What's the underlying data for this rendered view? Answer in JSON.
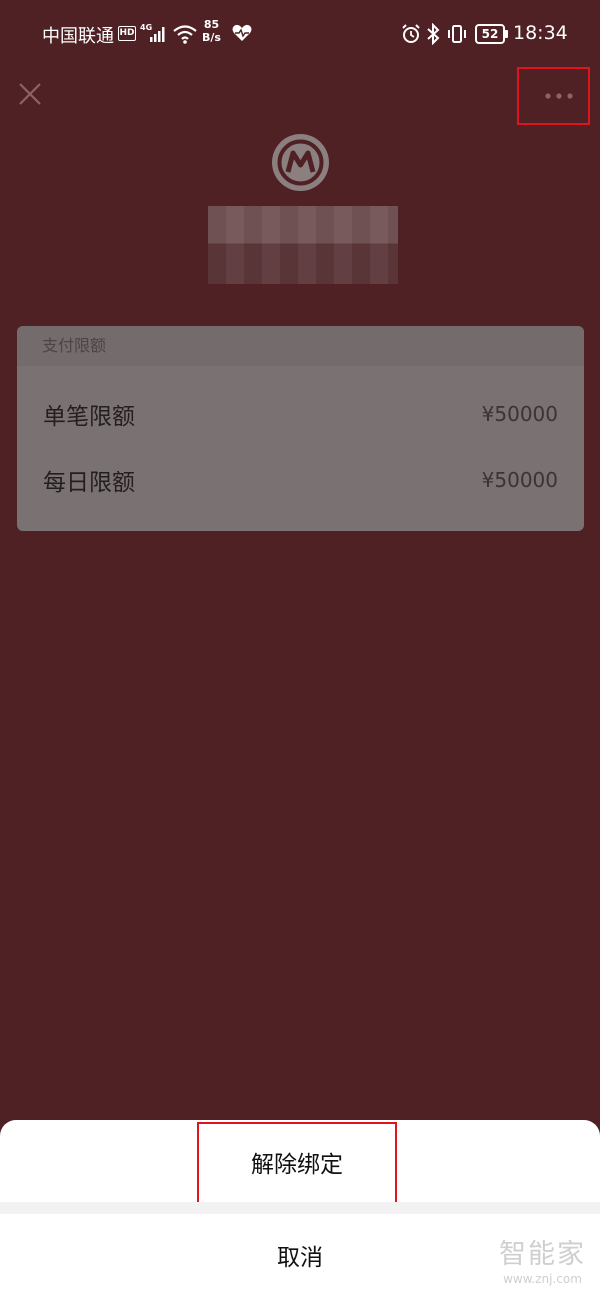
{
  "status_bar": {
    "carrier": "中国联通",
    "hd_badge": "HD",
    "network_type": "4G",
    "net_speed_value": "85",
    "net_speed_unit": "B/s",
    "battery": "52",
    "time": "18:34",
    "icons": [
      "signal-icon",
      "wifi-icon",
      "heart-icon",
      "alarm-icon",
      "bluetooth-icon",
      "vibrate-icon",
      "battery-icon"
    ]
  },
  "header": {
    "close_icon": "close-icon",
    "more_icon": "more-dots-icon",
    "bank_logo_icon": "bank-logo-icon"
  },
  "limits_card": {
    "heading": "支付限额",
    "rows": [
      {
        "label": "单笔限额",
        "value": "¥50000"
      },
      {
        "label": "每日限额",
        "value": "¥50000"
      }
    ]
  },
  "action_sheet": {
    "unbind_label": "解除绑定",
    "cancel_label": "取消"
  },
  "watermark": {
    "main": "智能家",
    "sub": "www.znj.com"
  },
  "colors": {
    "backdrop": "#4f2124",
    "card": "#7a7172",
    "highlight_box": "#e0141c",
    "sheet": "#ffffff"
  }
}
